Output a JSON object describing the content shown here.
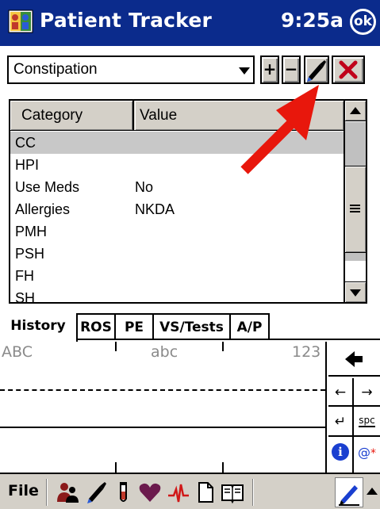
{
  "titlebar": {
    "app_title": "Patient Tracker",
    "clock": "9:25a",
    "ok_label": "ok"
  },
  "toolbar": {
    "dropdown_value": "Constipation",
    "plus_label": "+",
    "minus_label": "−"
  },
  "table": {
    "columns": [
      "Category",
      "Value"
    ],
    "rows": [
      {
        "category": "CC",
        "value": "",
        "selected": true
      },
      {
        "category": "HPI",
        "value": ""
      },
      {
        "category": "Use Meds",
        "value": "No"
      },
      {
        "category": "Allergies",
        "value": "NKDA"
      },
      {
        "category": "PMH",
        "value": ""
      },
      {
        "category": "PSH",
        "value": ""
      },
      {
        "category": "FH",
        "value": ""
      },
      {
        "category": "SH",
        "value": ""
      }
    ]
  },
  "tabs": [
    "History",
    "ROS",
    "PE",
    "VS/Tests",
    "A/P"
  ],
  "active_tab": "History",
  "input_panel": {
    "upper_label": "ABC",
    "lower_label": "abc",
    "number_label": "123",
    "space_label": "spc",
    "symbol_label": "@",
    "backspace_icon": "left-arrow-icon"
  },
  "commandbar": {
    "file_label": "File",
    "icons": [
      "patients-icon",
      "medication-icon",
      "test-tube-icon",
      "heart-icon",
      "ecg-icon",
      "document-icon",
      "book-icon"
    ]
  },
  "colors": {
    "titlebar": "#0b2b8c",
    "annotation_arrow": "#e8170c",
    "delete_x": "#c0001a"
  }
}
